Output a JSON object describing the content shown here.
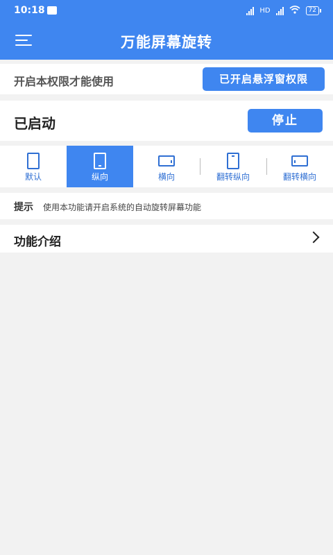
{
  "status_bar": {
    "time": "10:18",
    "network": "HD",
    "battery": "72"
  },
  "app": {
    "title": "万能屏幕旋转",
    "accent": "#3f86f0"
  },
  "permission": {
    "label": "开启本权限才能使用",
    "button": "已开启悬浮窗权限"
  },
  "service": {
    "status": "已启动",
    "button": "停止"
  },
  "modes": [
    {
      "label": "默认",
      "icon": "portrait-outline-icon",
      "active": false
    },
    {
      "label": "纵向",
      "icon": "phone-portrait-icon",
      "active": true
    },
    {
      "label": "横向",
      "icon": "phone-landscape-icon",
      "active": false
    },
    {
      "label": "翻转纵向",
      "icon": "phone-reverse-portrait-icon",
      "active": false
    },
    {
      "label": "翻转横向",
      "icon": "phone-reverse-landscape-icon",
      "active": false
    }
  ],
  "tip": {
    "heading": "提示",
    "text": "使用本功能请开启系统的自动旋转屏幕功能"
  },
  "intro": {
    "label": "功能介绍"
  }
}
